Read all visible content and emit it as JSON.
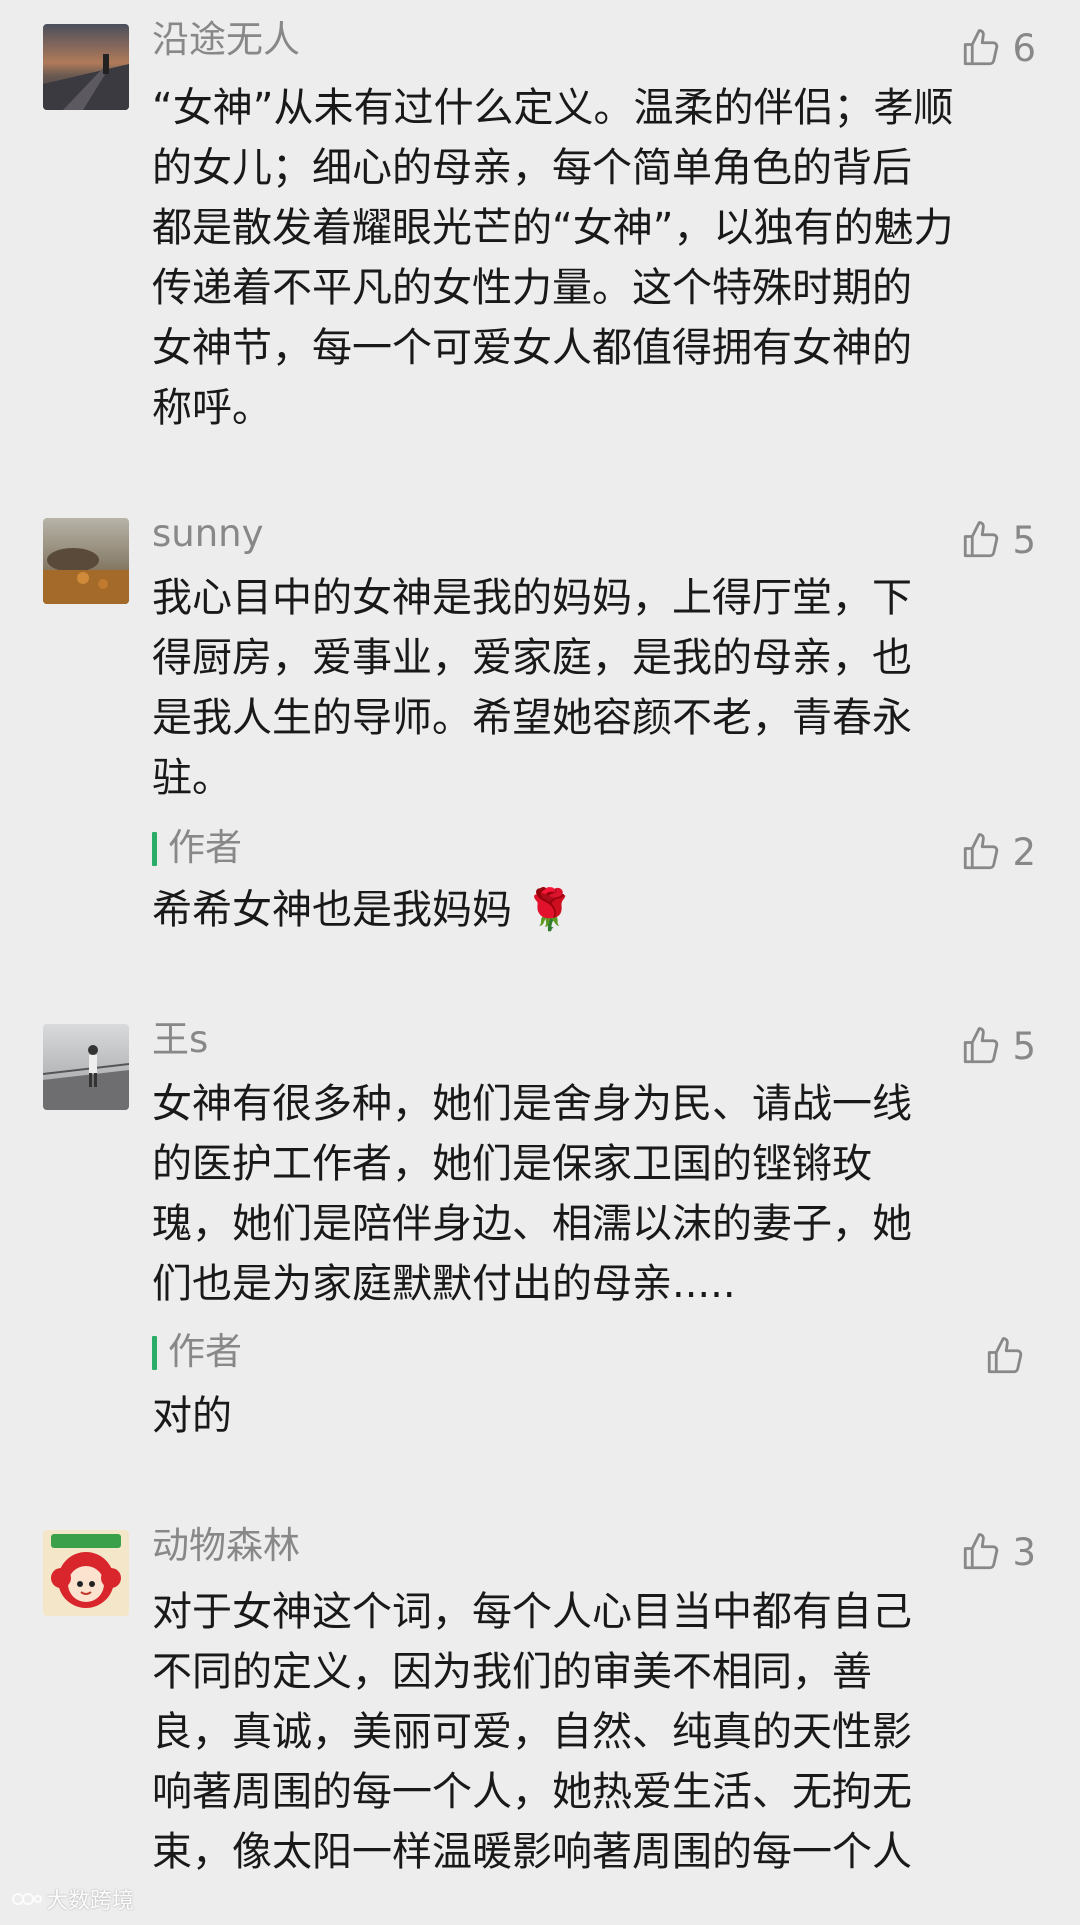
{
  "comments": [
    {
      "name": "沿途无人",
      "likes": "6",
      "text": "“女神”从未有过什么定义。温柔的伴侣；孝顺\n的女儿；细心的母亲，每个简单角色的背后\n都是散发着耀眼光芒的“女神”，以独有的魅力\n传递着不平凡的女性力量。这个特殊时期的\n女神节，每一个可爱女人都值得拥有女神的\n称呼。"
    },
    {
      "name": "sunny",
      "likes": "5",
      "text": "我心目中的女神是我的妈妈，上得厅堂，下\n得厨房，爱事业，爱家庭，是我的母亲，也\n是我人生的导师。希望她容颜不老，青春永\n驻。",
      "reply": {
        "tag": "作者",
        "likes": "2",
        "text": "希希女神也是我妈妈 🌹"
      }
    },
    {
      "name": "王s",
      "likes": "5",
      "text": "女神有很多种，她们是舍身为民、请战一线\n的医护工作者，她们是保家卫国的铿锵玫\n瑰，她们是陪伴身边、相濡以沫的妻子，她\n们也是为家庭默默付出的母亲.....",
      "reply": {
        "tag": "作者",
        "likes": "",
        "text": "对的"
      }
    },
    {
      "name": "动物森林",
      "likes": "3",
      "text": "对于女神这个词，每个人心目当中都有自己\n不同的定义，因为我们的审美不相同，善\n良，真诚，美丽可爱，自然、纯真的天性影\n响著周围的每一个人，她热爱生活、无拘无\n束，像太阳一样温暖影响著周围的每一个人"
    }
  ],
  "watermark": "大数跨境",
  "colors": {
    "background": "#ededed",
    "name_gray": "#888888",
    "text_black": "#191919",
    "author_bar_green": "#2aae67"
  },
  "icons": {
    "like": "thumbs-up-icon",
    "rose": "rose-emoji"
  }
}
